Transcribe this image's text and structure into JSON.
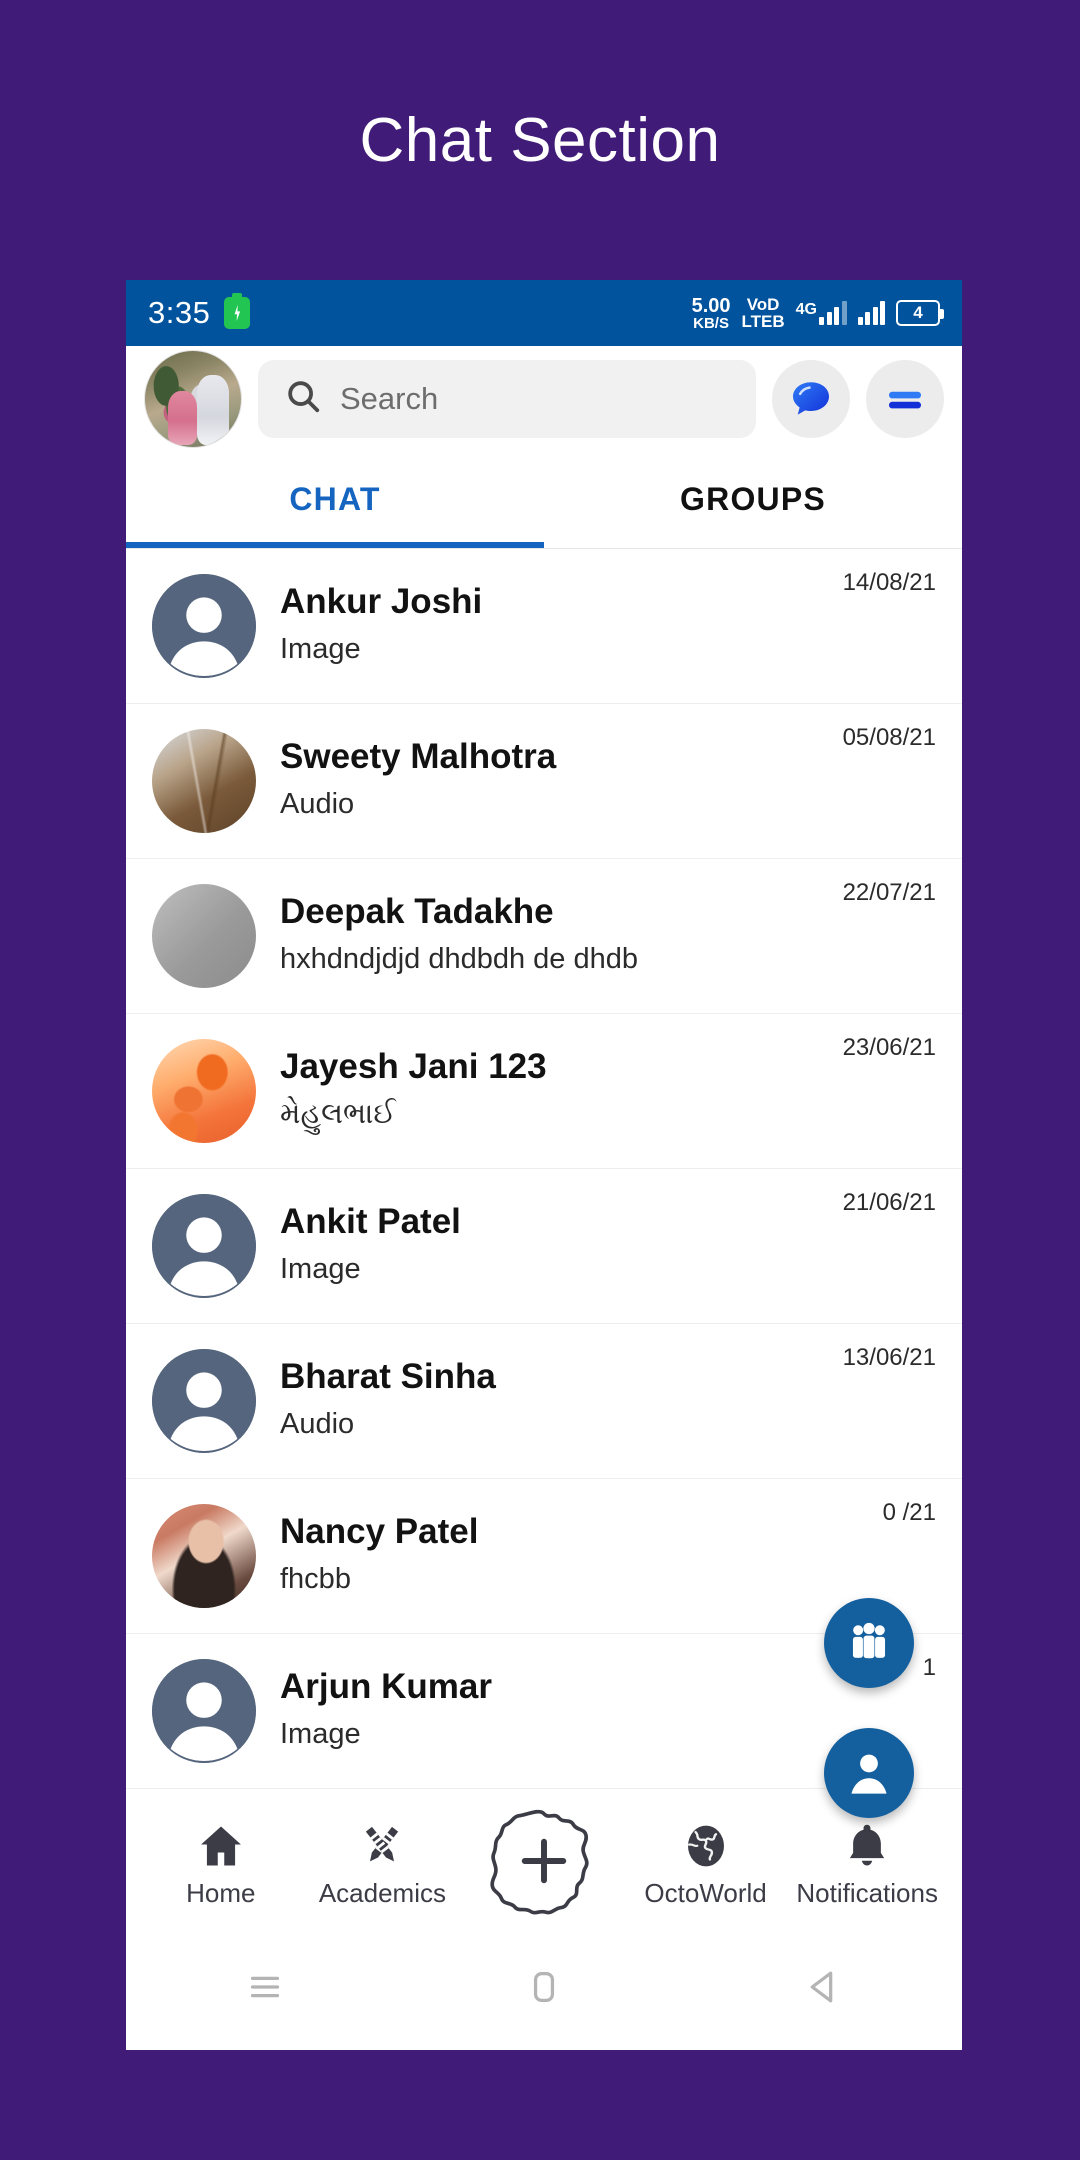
{
  "poster": {
    "title": "Chat Section",
    "bg_color": "#401B77"
  },
  "status_bar": {
    "time": "3:35",
    "charging_icon": "battery-charging-icon",
    "data_rate_value": "5.00",
    "data_rate_unit": "KB/S",
    "volte_top": "VoD",
    "volte_bottom": "LTEB",
    "network_type": "4G",
    "battery_level": "4",
    "bg_color": "#00539C"
  },
  "top_bar": {
    "profile_avatar": "user-profile-photo",
    "search": {
      "placeholder": "Search",
      "value": "",
      "icon": "search-icon"
    },
    "chat_button": {
      "icon": "chat-bubble-icon"
    },
    "menu_button": {
      "icon": "menu-bars-icon"
    }
  },
  "tabs": {
    "items": [
      {
        "label": "CHAT",
        "active": true
      },
      {
        "label": "GROUPS",
        "active": false
      }
    ],
    "active_color": "#1565C0"
  },
  "chat_list": {
    "rows": [
      {
        "name": "Ankur Joshi",
        "preview": "Image",
        "date": "14/08/21",
        "avatar": "default-person-avatar"
      },
      {
        "name": "Sweety Malhotra",
        "preview": "Audio",
        "date": "05/08/21",
        "avatar": "tiger-photo-avatar"
      },
      {
        "name": "Deepak Tadakhe",
        "preview": "hxhdndjdjd dhdbdh de dhdb",
        "date": "22/07/21",
        "avatar": "grey-photo-avatar"
      },
      {
        "name": "Jayesh Jani 123",
        "preview": "મેહુલભાઈ",
        "date": "23/06/21",
        "avatar": "jellyfish-photo-avatar"
      },
      {
        "name": "Ankit Patel",
        "preview": "Image",
        "date": "21/06/21",
        "avatar": "default-person-avatar"
      },
      {
        "name": "Bharat Sinha",
        "preview": "Audio",
        "date": "13/06/21",
        "avatar": "default-person-avatar"
      },
      {
        "name": "Nancy Patel",
        "preview": "fhcbb",
        "date": "0      /21",
        "avatar": "woman-photo-avatar"
      },
      {
        "name": "Arjun Kumar",
        "preview": "Image",
        "date": "1",
        "avatar": "default-person-avatar"
      }
    ]
  },
  "fabs": {
    "color": "#14609F",
    "group_button": {
      "icon": "people-group-icon"
    },
    "person_button": {
      "icon": "single-person-icon"
    }
  },
  "bottom_nav": {
    "items": [
      {
        "label": "Home",
        "icon": "home-icon"
      },
      {
        "label": "Academics",
        "icon": "pencils-crossed-icon"
      },
      {
        "label": "",
        "icon": "add-plus-badge-icon"
      },
      {
        "label": "OctoWorld",
        "icon": "globe-icon"
      },
      {
        "label": "Notifications",
        "icon": "bell-icon"
      }
    ]
  },
  "system_nav": {
    "recents": "hamburger-recents-icon",
    "home": "home-square-icon",
    "back": "back-triangle-icon"
  }
}
